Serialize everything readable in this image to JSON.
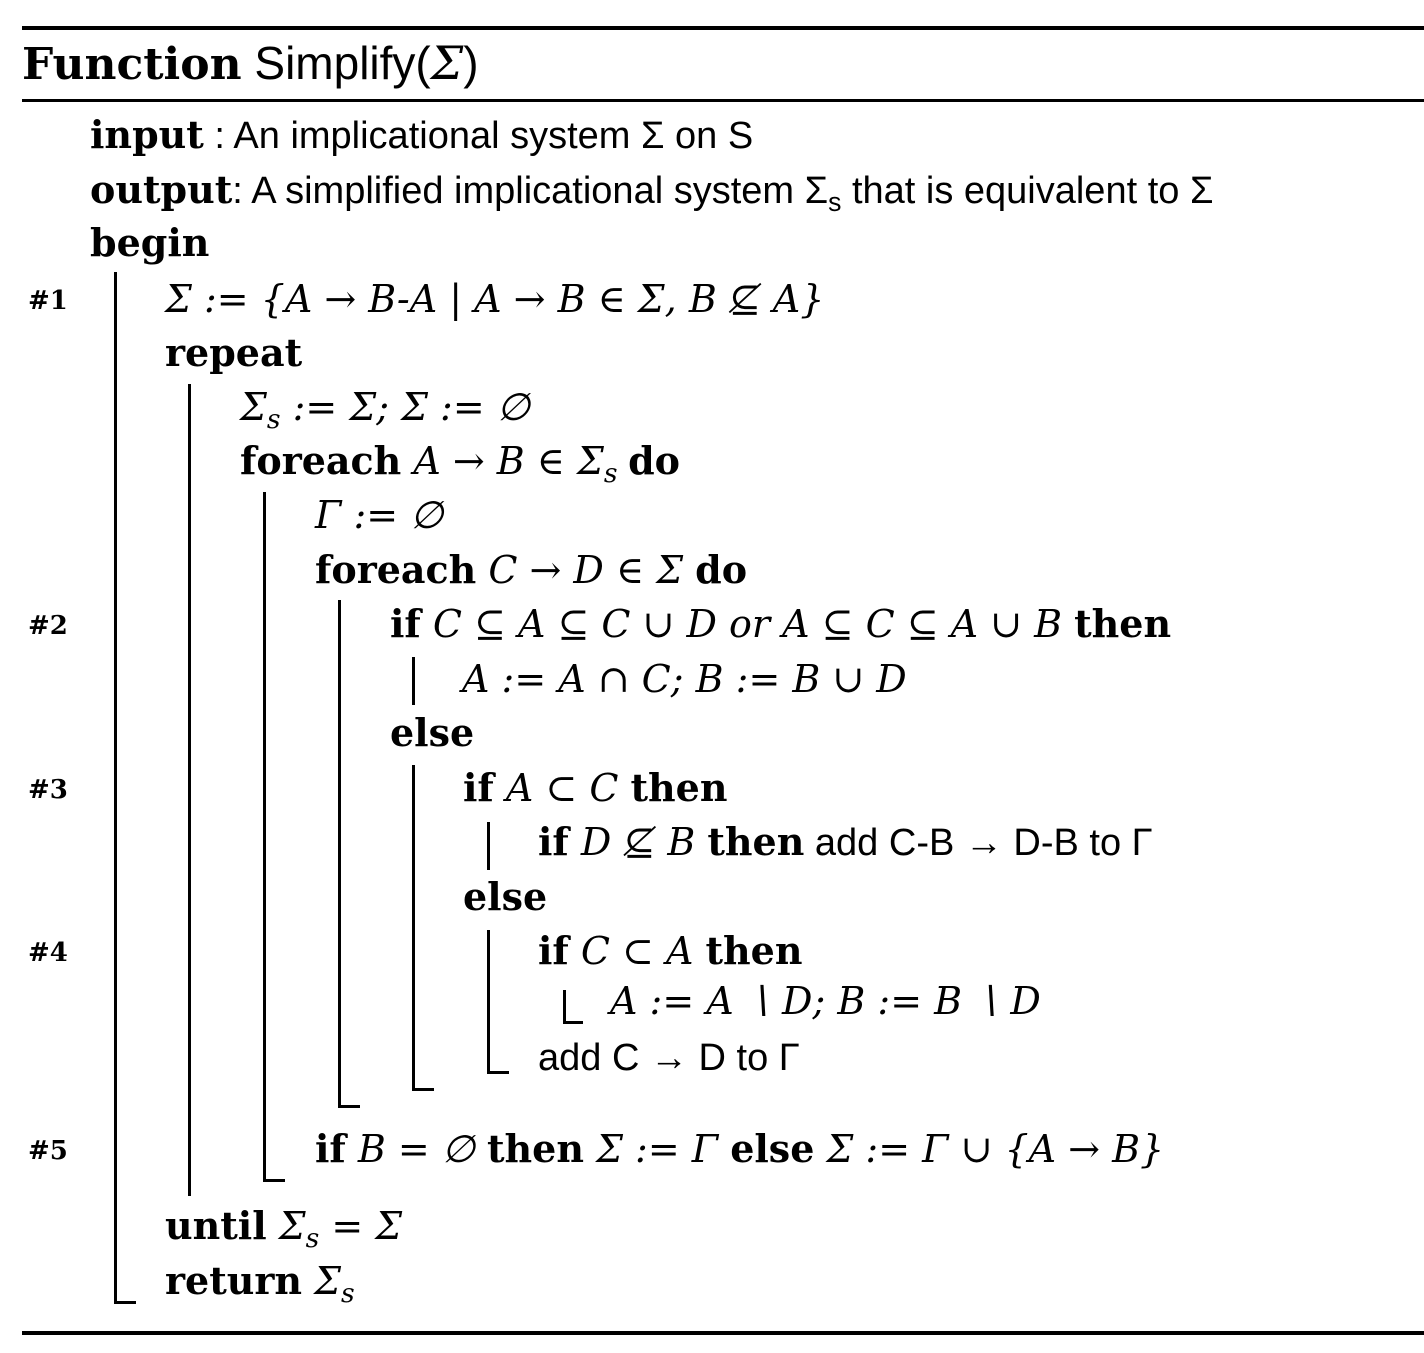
{
  "function_header": {
    "keyword": "Function",
    "name": "Simplify(",
    "param": "Σ",
    "close": ")"
  },
  "io": {
    "input_kw": "input",
    "input_text": " : An implicational system Σ on S",
    "output_kw": "output",
    "output_text": ": A simplified implicational system Σ",
    "output_sub": "s",
    "output_tail": " that is equivalent to Σ",
    "begin_kw": "begin"
  },
  "labels": [
    "#1",
    "#2",
    "#3",
    "#4",
    "#5"
  ],
  "lines": {
    "l1": "Σ := {A → B-A | A → B ∈ Σ, B ⊈ A}",
    "repeat_kw": "repeat",
    "l3a": "Σ",
    "l3sub": "s",
    "l3b": " := Σ;  Σ := ∅",
    "foreach1_kw": "foreach",
    "foreach1_a": " A → B ∈ Σ",
    "foreach1_sub": "s",
    "do_kw": "do",
    "gamma_init": "Γ := ∅",
    "foreach2_kw": "foreach",
    "foreach2_a": " C → D ∈ Σ ",
    "if_kw": "if",
    "if2_cond": " C ⊆ A ⊆ C ∪ D or A ⊆ C ⊆ A ∪ B ",
    "then_kw": "then",
    "assign2": "A := A ∩ C;  B := B ∪ D",
    "else_kw": "else",
    "if3_cond": " A ⊂ C ",
    "if3b_cond": " D ⊈ B ",
    "add3": " add C-B → D-B to Γ",
    "if4_cond": " C ⊂ A ",
    "assign4": "A := A ∖ D;  B := B ∖ D",
    "add4": "add C → D to Γ",
    "if5_cond": " B = ∅ ",
    "if5_then": " Σ := Γ ",
    "if5_else": "  Σ := Γ ∪ {A → B}",
    "until_kw": "until",
    "until_a": " Σ",
    "until_sub": "s",
    "until_b": " = Σ",
    "return_kw": "return",
    "return_a": " Σ",
    "return_sub": "s"
  }
}
